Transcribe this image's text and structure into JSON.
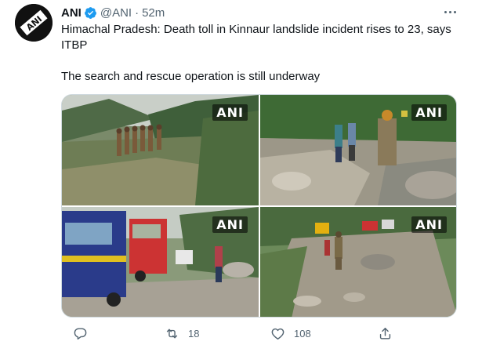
{
  "tweet": {
    "author": {
      "name": "ANI",
      "handle": "@ANI",
      "separator": "·",
      "time": "52m",
      "avatar_text": "ANI",
      "verified": true
    },
    "text_line1": "Himachal Pradesh: Death toll in Kinnaur landslide incident rises to 23, says ITBP",
    "text_line2": "The search and rescue operation is still underway",
    "media": [
      {
        "watermark": "ANI",
        "scene": "soldiers walking on mountain slope"
      },
      {
        "watermark": "ANI",
        "scene": "rescuers near landslide debris"
      },
      {
        "watermark": "ANI",
        "scene": "bus and fire truck on mountain road"
      },
      {
        "watermark": "ANI",
        "scene": "personnel on rocky road"
      }
    ],
    "actions": {
      "reply_count": "",
      "retweet_count": "18",
      "like_count": "108"
    }
  },
  "colors": {
    "text_primary": "#0f1419",
    "text_secondary": "#536471",
    "verified_blue": "#1d9bf0",
    "border": "#cfd9de"
  }
}
